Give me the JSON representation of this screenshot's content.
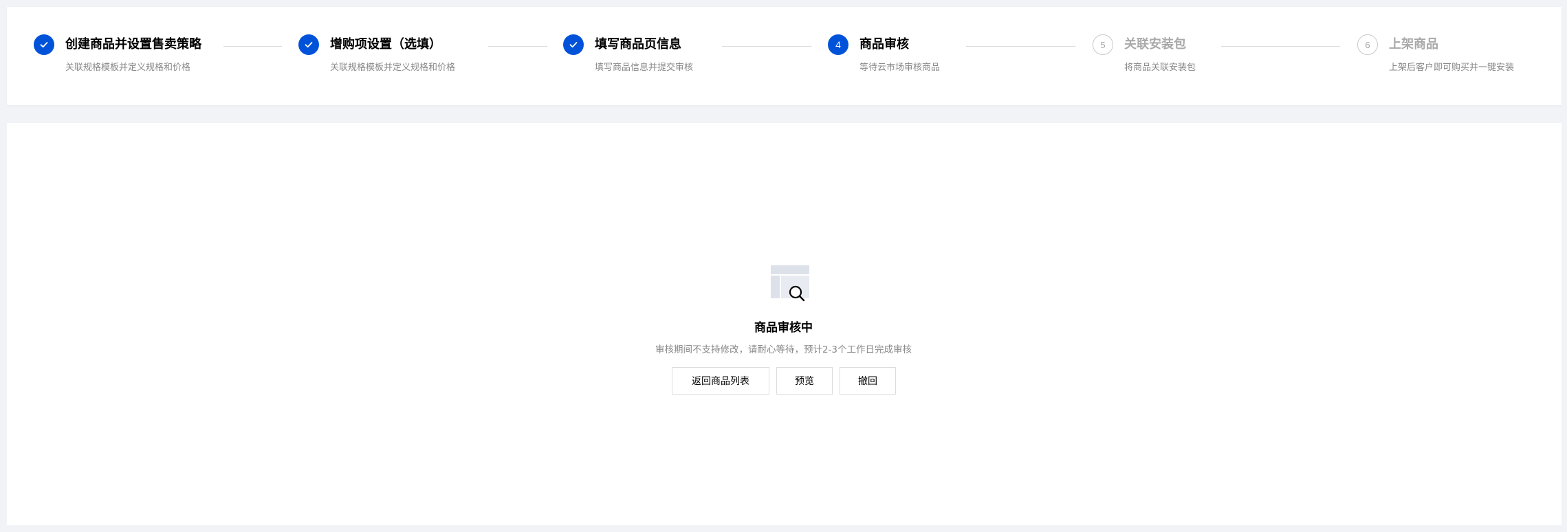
{
  "steps": [
    {
      "number": "1",
      "status": "done",
      "title": "创建商品并设置售卖策略",
      "desc": "关联规格模板并定义规格和价格"
    },
    {
      "number": "2",
      "status": "done",
      "title": "增购项设置（选填）",
      "desc": "关联规格模板并定义规格和价格"
    },
    {
      "number": "3",
      "status": "done",
      "title": "填写商品页信息",
      "desc": "填写商品信息并提交审核"
    },
    {
      "number": "4",
      "status": "current",
      "title": "商品审核",
      "desc": "等待云市场审核商品"
    },
    {
      "number": "5",
      "status": "todo",
      "title": "关联安装包",
      "desc": "将商品关联安装包"
    },
    {
      "number": "6",
      "status": "todo",
      "title": "上架商品",
      "desc": "上架后客户即可购买并一键安装"
    }
  ],
  "status": {
    "title": "商品审核中",
    "description": "审核期间不支持修改，请耐心等待，预计2-3个工作日完成审核",
    "icon": "document-search-icon"
  },
  "actions": {
    "back_label": "返回商品列表",
    "preview_label": "预览",
    "withdraw_label": "撤回"
  },
  "colors": {
    "accent": "#0052d9",
    "muted_text": "#888888",
    "todo_text": "#a9a9a9",
    "background": "#f2f3f7"
  }
}
